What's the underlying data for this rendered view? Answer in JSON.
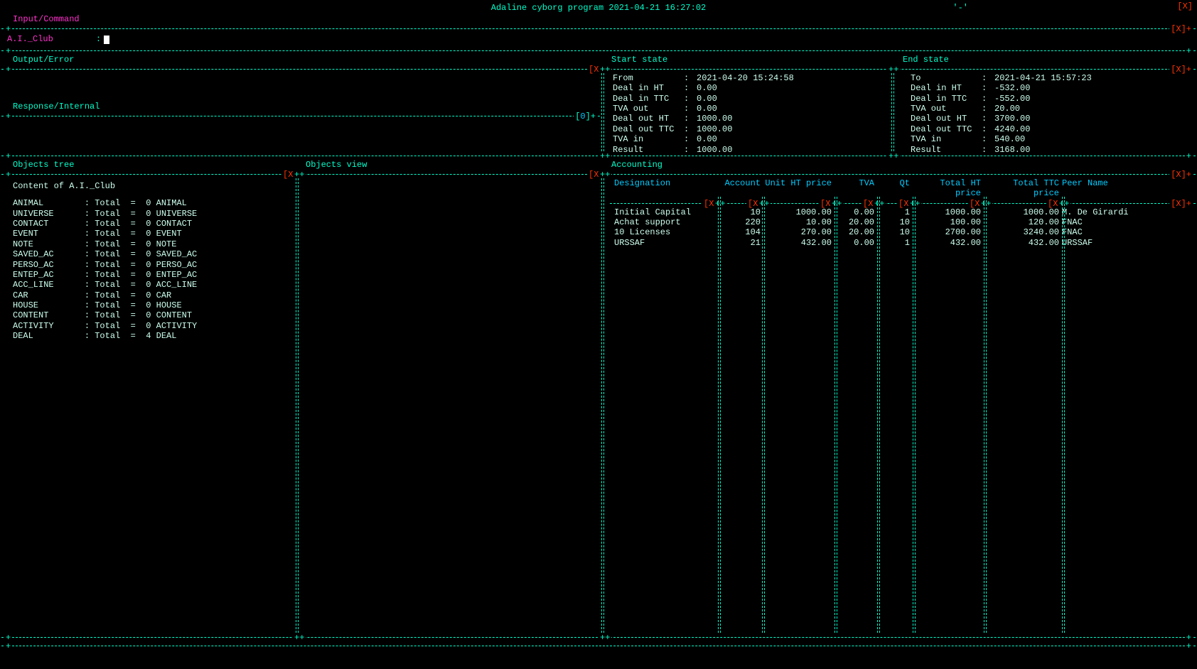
{
  "app": {
    "title": "Adaline cyborg program 2021-04-21 16:27:02",
    "quote": "'-'",
    "close": "[X]"
  },
  "panels": {
    "input": "Input/Command",
    "output": "Output/Error",
    "response": "Response/Internal",
    "objtree": "Objects tree",
    "objview": "Objects view",
    "start": "Start state",
    "end": "End state",
    "accounting": "Accounting"
  },
  "prompt": {
    "label": "A.I._Club",
    "sep": ":"
  },
  "start_state": [
    {
      "k": "From",
      "v": "2021-04-20 15:24:58"
    },
    {
      "k": "Deal in  HT",
      "v": "0.00"
    },
    {
      "k": "Deal in  TTC",
      "v": "0.00"
    },
    {
      "k": "TVA  out",
      "v": "0.00"
    },
    {
      "k": "Deal out HT",
      "v": "1000.00"
    },
    {
      "k": "Deal out TTC",
      "v": "1000.00"
    },
    {
      "k": "TVA  in",
      "v": "0.00"
    },
    {
      "k": "Result",
      "v": "1000.00"
    }
  ],
  "end_state": [
    {
      "k": "To",
      "v": "2021-04-21 15:57:23"
    },
    {
      "k": "Deal in  HT",
      "v": "-532.00"
    },
    {
      "k": "Deal in  TTC",
      "v": "-552.00"
    },
    {
      "k": "TVA  out",
      "v": "20.00"
    },
    {
      "k": "Deal out HT",
      "v": "3700.00"
    },
    {
      "k": "Deal out TTC",
      "v": "4240.00"
    },
    {
      "k": "TVA  in",
      "v": "540.00"
    },
    {
      "k": "Result",
      "v": "3168.00"
    }
  ],
  "tree": {
    "header": "Content of A.I._Club",
    "items": [
      {
        "name": "ANIMAL",
        "total": 0,
        "type": "ANIMAL"
      },
      {
        "name": "UNIVERSE",
        "total": 0,
        "type": "UNIVERSE"
      },
      {
        "name": "CONTACT",
        "total": 0,
        "type": "CONTACT"
      },
      {
        "name": "EVENT",
        "total": 0,
        "type": "EVENT"
      },
      {
        "name": "NOTE",
        "total": 0,
        "type": "NOTE"
      },
      {
        "name": "SAVED_AC",
        "total": 0,
        "type": "SAVED_AC"
      },
      {
        "name": "PERSO_AC",
        "total": 0,
        "type": "PERSO_AC"
      },
      {
        "name": "ENTEP_AC",
        "total": 0,
        "type": "ENTEP_AC"
      },
      {
        "name": "ACC_LINE",
        "total": 0,
        "type": "ACC_LINE"
      },
      {
        "name": "CAR",
        "total": 0,
        "type": "CAR"
      },
      {
        "name": "HOUSE",
        "total": 0,
        "type": "HOUSE"
      },
      {
        "name": "CONTENT",
        "total": 0,
        "type": "CONTENT"
      },
      {
        "name": "ACTIVITY",
        "total": 0,
        "type": "ACTIVITY"
      },
      {
        "name": "DEAL",
        "total": 4,
        "type": "DEAL"
      }
    ]
  },
  "accounting": {
    "headers": {
      "designation": "Designation",
      "account": "Account",
      "unit": "Unit HT price",
      "tva": "TVA",
      "qt": "Qt",
      "totalht": "Total HT price",
      "totalttc": "Total TTC price",
      "peer": "Peer Name"
    },
    "rows": [
      {
        "des": "Initial Capital",
        "acc": "10",
        "unit": "1000.00",
        "tva": "0.00",
        "qt": "1",
        "tht": "1000.00",
        "ttc": "1000.00",
        "peer": "M. De Girardi"
      },
      {
        "des": "Achat support",
        "acc": "220",
        "unit": "10.00",
        "tva": "20.00",
        "qt": "10",
        "tht": "100.00",
        "ttc": "120.00",
        "peer": "FNAC"
      },
      {
        "des": "10 Licenses",
        "acc": "104",
        "unit": "270.00",
        "tva": "20.00",
        "qt": "10",
        "tht": "2700.00",
        "ttc": "3240.00",
        "peer": "FNAC"
      },
      {
        "des": "URSSAF",
        "acc": "21",
        "unit": "432.00",
        "tva": "0.00",
        "qt": "1",
        "tht": "432.00",
        "ttc": "432.00",
        "peer": "URSSAF"
      }
    ]
  },
  "marks": {
    "closex": "[X]",
    "plusx": "[X]+",
    "xplus": "+[X]",
    "plus": "+",
    "doubleplus": "++"
  }
}
